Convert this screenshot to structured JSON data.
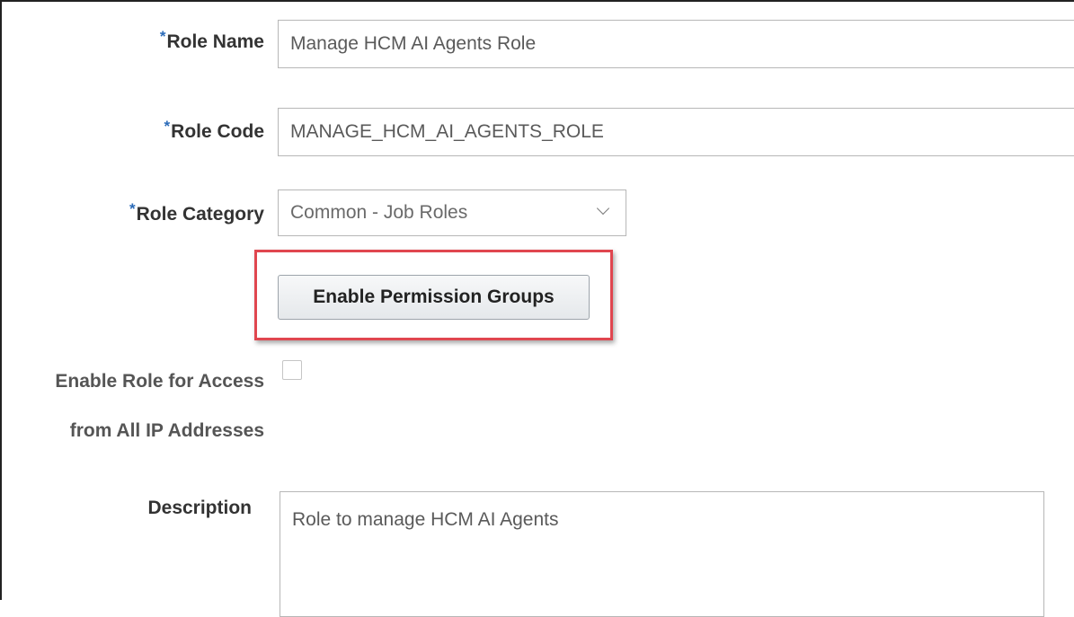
{
  "form": {
    "role_name": {
      "required_marker": "*",
      "label": "Role Name",
      "value": "Manage HCM AI Agents Role"
    },
    "role_code": {
      "required_marker": "*",
      "label": "Role Code",
      "value": "MANAGE_HCM_AI_AGENTS_ROLE"
    },
    "role_category": {
      "required_marker": "*",
      "label": "Role Category",
      "selected": "Common - Job Roles",
      "icon": "chevron-down-icon"
    },
    "enable_permission_groups_button": "Enable Permission Groups",
    "ip_access": {
      "label_line1": "Enable Role for Access",
      "label_line2": "from All IP Addresses",
      "checked": false
    },
    "description": {
      "label": "Description",
      "value": "Role to manage HCM AI Agents"
    }
  },
  "colors": {
    "required_marker": "#2a6ab8",
    "highlight_border": "#e0464f",
    "input_border": "#b7b7b7",
    "label_text": "#333333"
  }
}
